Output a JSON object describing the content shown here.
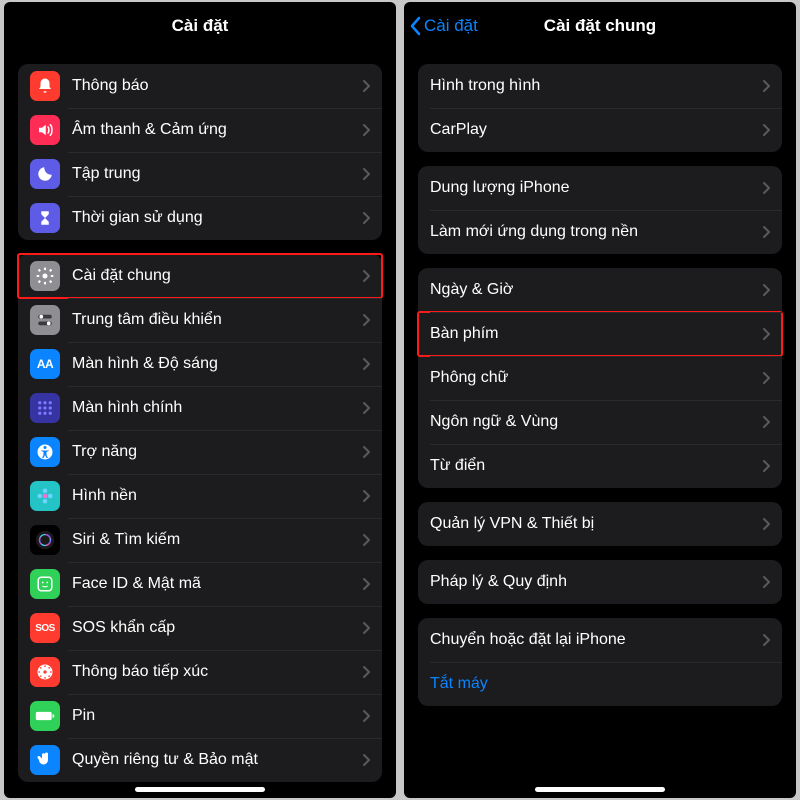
{
  "left": {
    "title": "Cài đặt",
    "group1": [
      {
        "label": "Thông báo",
        "icon": "bell",
        "bg": "#ff3b30"
      },
      {
        "label": "Âm thanh & Cảm ứng",
        "icon": "sound",
        "bg": "#ff2d55"
      },
      {
        "label": "Tập trung",
        "icon": "moon",
        "bg": "#5e5ce6"
      },
      {
        "label": "Thời gian sử dụng",
        "icon": "hourglass",
        "bg": "#5e5ce6"
      }
    ],
    "group2": [
      {
        "label": "Cài đặt chung",
        "icon": "gear",
        "bg": "#8e8e93",
        "highlight": true
      },
      {
        "label": "Trung tâm điều khiển",
        "icon": "switches",
        "bg": "#8e8e93"
      },
      {
        "label": "Màn hình & Độ sáng",
        "icon": "aa",
        "bg": "#0a84ff",
        "text": "AA"
      },
      {
        "label": "Màn hình chính",
        "icon": "grid",
        "bg": "#3634a3"
      },
      {
        "label": "Trợ năng",
        "icon": "access",
        "bg": "#0a84ff"
      },
      {
        "label": "Hình nền",
        "icon": "flower",
        "bg": "#24c4c6"
      },
      {
        "label": "Siri & Tìm kiếm",
        "icon": "siri",
        "bg": "#000000"
      },
      {
        "label": "Face ID & Mật mã",
        "icon": "face",
        "bg": "#30d158"
      },
      {
        "label": "SOS khẩn cấp",
        "icon": "sos",
        "bg": "#ff3b30",
        "text": "SOS"
      },
      {
        "label": "Thông báo tiếp xúc",
        "icon": "exposure",
        "bg": "#ff3b30"
      },
      {
        "label": "Pin",
        "icon": "battery",
        "bg": "#30d158"
      },
      {
        "label": "Quyền riêng tư & Bảo mật",
        "icon": "hand",
        "bg": "#0a84ff"
      }
    ]
  },
  "right": {
    "back": "Cài đặt",
    "title": "Cài đặt chung",
    "g_video": [
      {
        "label": "Hình trong hình"
      },
      {
        "label": "CarPlay"
      }
    ],
    "g_storage": [
      {
        "label": "Dung lượng iPhone"
      },
      {
        "label": "Làm mới ứng dụng trong nền"
      }
    ],
    "g_general": [
      {
        "label": "Ngày & Giờ"
      },
      {
        "label": "Bàn phím",
        "highlight": true
      },
      {
        "label": "Phông chữ"
      },
      {
        "label": "Ngôn ngữ & Vùng"
      },
      {
        "label": "Từ điển"
      }
    ],
    "g_vpn": [
      {
        "label": "Quản lý VPN & Thiết bị"
      }
    ],
    "g_legal": [
      {
        "label": "Pháp lý & Quy định"
      }
    ],
    "g_reset": [
      {
        "label": "Chuyển hoặc đặt lại iPhone"
      },
      {
        "label": "Tắt máy",
        "blue": true,
        "nochev": true
      }
    ]
  }
}
